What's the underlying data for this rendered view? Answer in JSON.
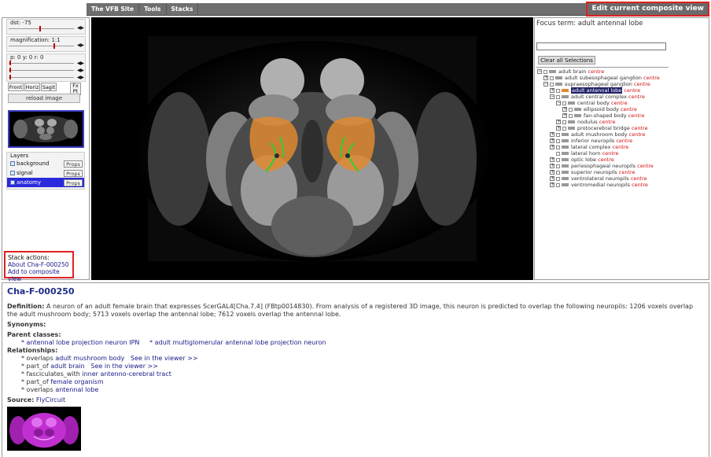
{
  "menu": {
    "items": [
      "The VFB Site",
      "Tools",
      "Stacks"
    ],
    "edit_composite": "Edit current composite view"
  },
  "controls": {
    "dst_label": "dst: -75",
    "dst_level": 0.45,
    "magnification_label": "magnification: 1:1",
    "magnification_level": 0.66,
    "xyz_label": "p: 0  y: 0  r: 0",
    "view_buttons": [
      "Front",
      "Horiz",
      "Sagit"
    ],
    "fx_pt": "Fx Pt",
    "reload": "reload image"
  },
  "layers": {
    "title": "Layers",
    "items": [
      {
        "name": "background",
        "props": "Props",
        "selected": false
      },
      {
        "name": "signal",
        "props": "Props",
        "selected": false
      },
      {
        "name": "anatomy",
        "props": "Props",
        "selected": true
      }
    ]
  },
  "stack_actions": {
    "title": "Stack actions:",
    "about": "About Cha-F-000250",
    "add": "Add to composite view"
  },
  "focus": {
    "label": "Focus term: adult antennal lobe",
    "input_value": "",
    "clear_button": "Clear all Selections"
  },
  "tree": [
    {
      "label": "adult brain",
      "centre": "centre",
      "toggle": "-",
      "depth": 0
    },
    {
      "label": "adult subesophageal ganglion",
      "centre": "centre",
      "toggle": "+",
      "depth": 1
    },
    {
      "label": "supraesophageal ganglion",
      "centre": "centre",
      "toggle": "-",
      "depth": 1
    },
    {
      "label": "adult antennal lobe",
      "centre": "centre",
      "toggle": "+",
      "depth": 2,
      "selected": true
    },
    {
      "label": "adult central complex",
      "centre": "centre",
      "toggle": "-",
      "depth": 2
    },
    {
      "label": "central body",
      "centre": "centre",
      "toggle": "-",
      "depth": 3
    },
    {
      "label": "ellipsoid body",
      "centre": "centre",
      "toggle": "+",
      "depth": 4
    },
    {
      "label": "fan-shaped body",
      "centre": "centre",
      "toggle": "+",
      "depth": 4
    },
    {
      "label": "nodulus",
      "centre": "centre",
      "toggle": "+",
      "depth": 3
    },
    {
      "label": "protocerebral bridge",
      "centre": "centre",
      "toggle": "+",
      "depth": 3
    },
    {
      "label": "adult mushroom body",
      "centre": "centre",
      "toggle": "+",
      "depth": 2
    },
    {
      "label": "inferior neuropils",
      "centre": "centre",
      "toggle": "+",
      "depth": 2
    },
    {
      "label": "lateral complex",
      "centre": "centre",
      "toggle": "+",
      "depth": 2
    },
    {
      "label": "lateral horn",
      "centre": "centre",
      "toggle": "",
      "depth": 2
    },
    {
      "label": "optic lobe",
      "centre": "centre",
      "toggle": "+",
      "depth": 2
    },
    {
      "label": "periesophageal neuropils",
      "centre": "centre",
      "toggle": "+",
      "depth": 2
    },
    {
      "label": "superior neuropils",
      "centre": "centre",
      "toggle": "+",
      "depth": 2
    },
    {
      "label": "ventrolateral neuropils",
      "centre": "centre",
      "toggle": "+",
      "depth": 2
    },
    {
      "label": "ventromedial neuropils",
      "centre": "centre",
      "toggle": "+",
      "depth": 2
    }
  ],
  "info": {
    "title": "Cha-F-000250",
    "definition_label": "Definition:",
    "definition": "A neuron of an adult female brain that expresses ScerGAL4[Cha.7.4] (FBtp0014830). From analysis of a registered 3D image, this neuron is predicted to overlap the following neuropils: 1206 voxels overlap the adult mushroom body; 5713 voxels overlap the antennal lobe; 7612 voxels overlap the antennal lobe.",
    "synonyms_label": "Synonyms:",
    "parent_classes_label": "Parent classes:",
    "parent_1": "* antennal lobe projection neuron IPN",
    "parent_2": "* adult multiglomerular antennal lobe projection neuron",
    "relationships_label": "Relationships:",
    "rel_1_prefix": "* overlaps",
    "rel_1_target": "adult mushroom body",
    "rel_1_link": "See in the viewer >>",
    "rel_2_prefix": "* part_of",
    "rel_2_target": "adult brain",
    "rel_2_link": "See in the viewer >>",
    "rel_3_prefix": "* fasciculates_with",
    "rel_3_target": "inner antenno-cerebral tract",
    "rel_4_prefix": "* part_of",
    "rel_4_target": "female organism",
    "rel_5_prefix": "* overlaps",
    "rel_5_target": "antennal lobe",
    "source_label": "Source:",
    "source_link": "FlyCircuit"
  },
  "colors": {
    "highlight_red": "#e02020",
    "antennal_lobe": "#e08a30",
    "signal": "#33cc33",
    "selected_layer": "#2a2adc",
    "source_magenta": "#c030d0"
  }
}
